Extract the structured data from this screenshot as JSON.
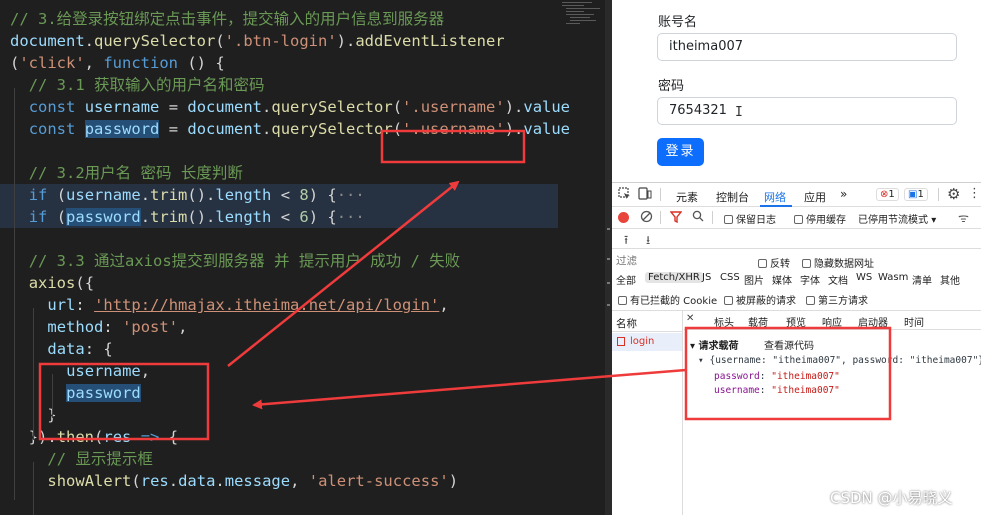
{
  "editor": {
    "lines": [
      {
        "indent": 0,
        "hl": false,
        "tokens": [
          [
            "c",
            "// 3.给登录按钮绑定点击事件，提交输入的用户信息到服务器"
          ]
        ]
      },
      {
        "indent": 0,
        "hl": false,
        "tokens": [
          [
            "v",
            "document"
          ],
          [
            "p",
            "."
          ],
          [
            "f",
            "querySelector"
          ],
          [
            "p",
            "("
          ],
          [
            "s",
            "'.btn-login'"
          ],
          [
            "p",
            ")."
          ],
          [
            "f",
            "addEventListener"
          ]
        ]
      },
      {
        "indent": 0,
        "hl": false,
        "tokens": [
          [
            "p",
            "("
          ],
          [
            "s",
            "'click'"
          ],
          [
            "p",
            ", "
          ],
          [
            "k",
            "function"
          ],
          [
            "p",
            " () {"
          ]
        ]
      },
      {
        "indent": 2,
        "hl": false,
        "tokens": [
          [
            "c",
            "// 3.1 获取输入的用户名和密码"
          ]
        ]
      },
      {
        "indent": 2,
        "hl": false,
        "tokens": [
          [
            "k",
            "const"
          ],
          [
            "p",
            " "
          ],
          [
            "v",
            "username"
          ],
          [
            "p",
            " = "
          ],
          [
            "v",
            "document"
          ],
          [
            "p",
            "."
          ],
          [
            "f",
            "querySelector"
          ],
          [
            "p",
            "("
          ],
          [
            "s",
            "'.username'"
          ],
          [
            "p",
            ")."
          ],
          [
            "v",
            "value"
          ]
        ]
      },
      {
        "indent": 2,
        "hl": false,
        "tokens": [
          [
            "k",
            "const"
          ],
          [
            "p",
            " "
          ],
          [
            "vsel",
            "password"
          ],
          [
            "p",
            " = "
          ],
          [
            "v",
            "document"
          ],
          [
            "p",
            "."
          ],
          [
            "f",
            "querySelector"
          ],
          [
            "p",
            "("
          ],
          [
            "s",
            "'.username'"
          ],
          [
            "p",
            ")."
          ],
          [
            "v",
            "value"
          ]
        ]
      },
      {
        "indent": 0,
        "hl": false,
        "tokens": []
      },
      {
        "indent": 2,
        "hl": false,
        "tokens": [
          [
            "c",
            "// 3.2用户名 密码 长度判断"
          ]
        ]
      },
      {
        "indent": 2,
        "hl": true,
        "tokens": [
          [
            "k",
            "if"
          ],
          [
            "p",
            " ("
          ],
          [
            "v",
            "username"
          ],
          [
            "p",
            "."
          ],
          [
            "f",
            "trim"
          ],
          [
            "p",
            "()."
          ],
          [
            "v",
            "length"
          ],
          [
            "p",
            " < "
          ],
          [
            "n",
            "8"
          ],
          [
            "p",
            ") {"
          ],
          [
            "o",
            "···"
          ]
        ]
      },
      {
        "indent": 2,
        "hl": true,
        "tokens": [
          [
            "k",
            "if"
          ],
          [
            "p",
            " ("
          ],
          [
            "vsel",
            "password"
          ],
          [
            "p",
            "."
          ],
          [
            "f",
            "trim"
          ],
          [
            "p",
            "()."
          ],
          [
            "v",
            "length"
          ],
          [
            "p",
            " < "
          ],
          [
            "n",
            "6"
          ],
          [
            "p",
            ") {"
          ],
          [
            "o",
            "···"
          ]
        ]
      },
      {
        "indent": 0,
        "hl": false,
        "tokens": []
      },
      {
        "indent": 2,
        "hl": false,
        "tokens": [
          [
            "c",
            "// 3.3 通过axios提交到服务器 并 提示用户 成功 / 失败"
          ]
        ]
      },
      {
        "indent": 2,
        "hl": false,
        "tokens": [
          [
            "f",
            "axios"
          ],
          [
            "p",
            "({"
          ]
        ]
      },
      {
        "indent": 4,
        "hl": false,
        "tokens": [
          [
            "v",
            "url"
          ],
          [
            "p",
            ": "
          ],
          [
            "su",
            "'http://hmajax.itheima.net/api/login'"
          ],
          [
            "p",
            ","
          ]
        ]
      },
      {
        "indent": 4,
        "hl": false,
        "tokens": [
          [
            "v",
            "method"
          ],
          [
            "p",
            ": "
          ],
          [
            "s",
            "'post'"
          ],
          [
            "p",
            ","
          ]
        ]
      },
      {
        "indent": 4,
        "hl": false,
        "tokens": [
          [
            "v",
            "data"
          ],
          [
            "p",
            ": {"
          ]
        ]
      },
      {
        "indent": 6,
        "hl": false,
        "tokens": [
          [
            "v",
            "username"
          ],
          [
            "p",
            ","
          ]
        ]
      },
      {
        "indent": 6,
        "hl": false,
        "tokens": [
          [
            "vsel",
            "password"
          ]
        ]
      },
      {
        "indent": 4,
        "hl": false,
        "tokens": [
          [
            "p",
            "}"
          ]
        ]
      },
      {
        "indent": 2,
        "hl": false,
        "tokens": [
          [
            "p",
            "})."
          ],
          [
            "f",
            "then"
          ],
          [
            "p",
            "("
          ],
          [
            "v",
            "res"
          ],
          [
            "p",
            " "
          ],
          [
            "k",
            "=>"
          ],
          [
            "p",
            " {"
          ]
        ]
      },
      {
        "indent": 4,
        "hl": false,
        "tokens": [
          [
            "c",
            "// 显示提示框"
          ]
        ]
      },
      {
        "indent": 4,
        "hl": false,
        "tokens": [
          [
            "f",
            "showAlert"
          ],
          [
            "p",
            "("
          ],
          [
            "v",
            "res"
          ],
          [
            "p",
            "."
          ],
          [
            "v",
            "data"
          ],
          [
            "p",
            "."
          ],
          [
            "v",
            "message"
          ],
          [
            "p",
            ", "
          ],
          [
            "s",
            "'alert-success'"
          ],
          [
            "p",
            ")"
          ]
        ]
      }
    ]
  },
  "form": {
    "username_label": "账号名",
    "username_value": "itheima007",
    "password_label": "密码",
    "password_value": "7654321",
    "cursor_glyph": "I",
    "login_label": "登录"
  },
  "devtools": {
    "tabs": [
      "元素",
      "控制台",
      "网络",
      "应用"
    ],
    "active_tab": "网络",
    "more_tabs": "»",
    "errors_count": "1",
    "messages_count": "1",
    "preserve_log": "保留日志",
    "disable_cache": "停用缓存",
    "throttle": "已停用节流模式",
    "filter_placeholder": "过滤",
    "invert": "反转",
    "hide_data_urls": "隐藏数据网址",
    "type_filters": [
      "全部",
      "Fetch/XHR",
      "JS",
      "CSS",
      "图片",
      "媒体",
      "字体",
      "文档",
      "WS",
      "Wasm",
      "清单",
      "其他"
    ],
    "active_type_filter": "Fetch/XHR",
    "blocked_cookies": "有已拦截的 Cookie",
    "blocked_requests": "被屏蔽的请求",
    "third_party": "第三方请求",
    "name_column": "名称",
    "request": "login",
    "detail_tabs": [
      "标头",
      "载荷",
      "预览",
      "响应",
      "启动器",
      "时间"
    ],
    "active_detail_tab": "载荷",
    "payload_title": "请求载荷",
    "view_source": "查看源代码",
    "payload_summary": "{username: \"itheima007\", password: \"itheima007\"}",
    "payload_fields": [
      {
        "key": "password",
        "value": "\"itheima007\""
      },
      {
        "key": "username",
        "value": "\"itheima007\""
      }
    ]
  },
  "watermark": "CSDN @小易晓义",
  "annotation_color": "#ef3b3b"
}
